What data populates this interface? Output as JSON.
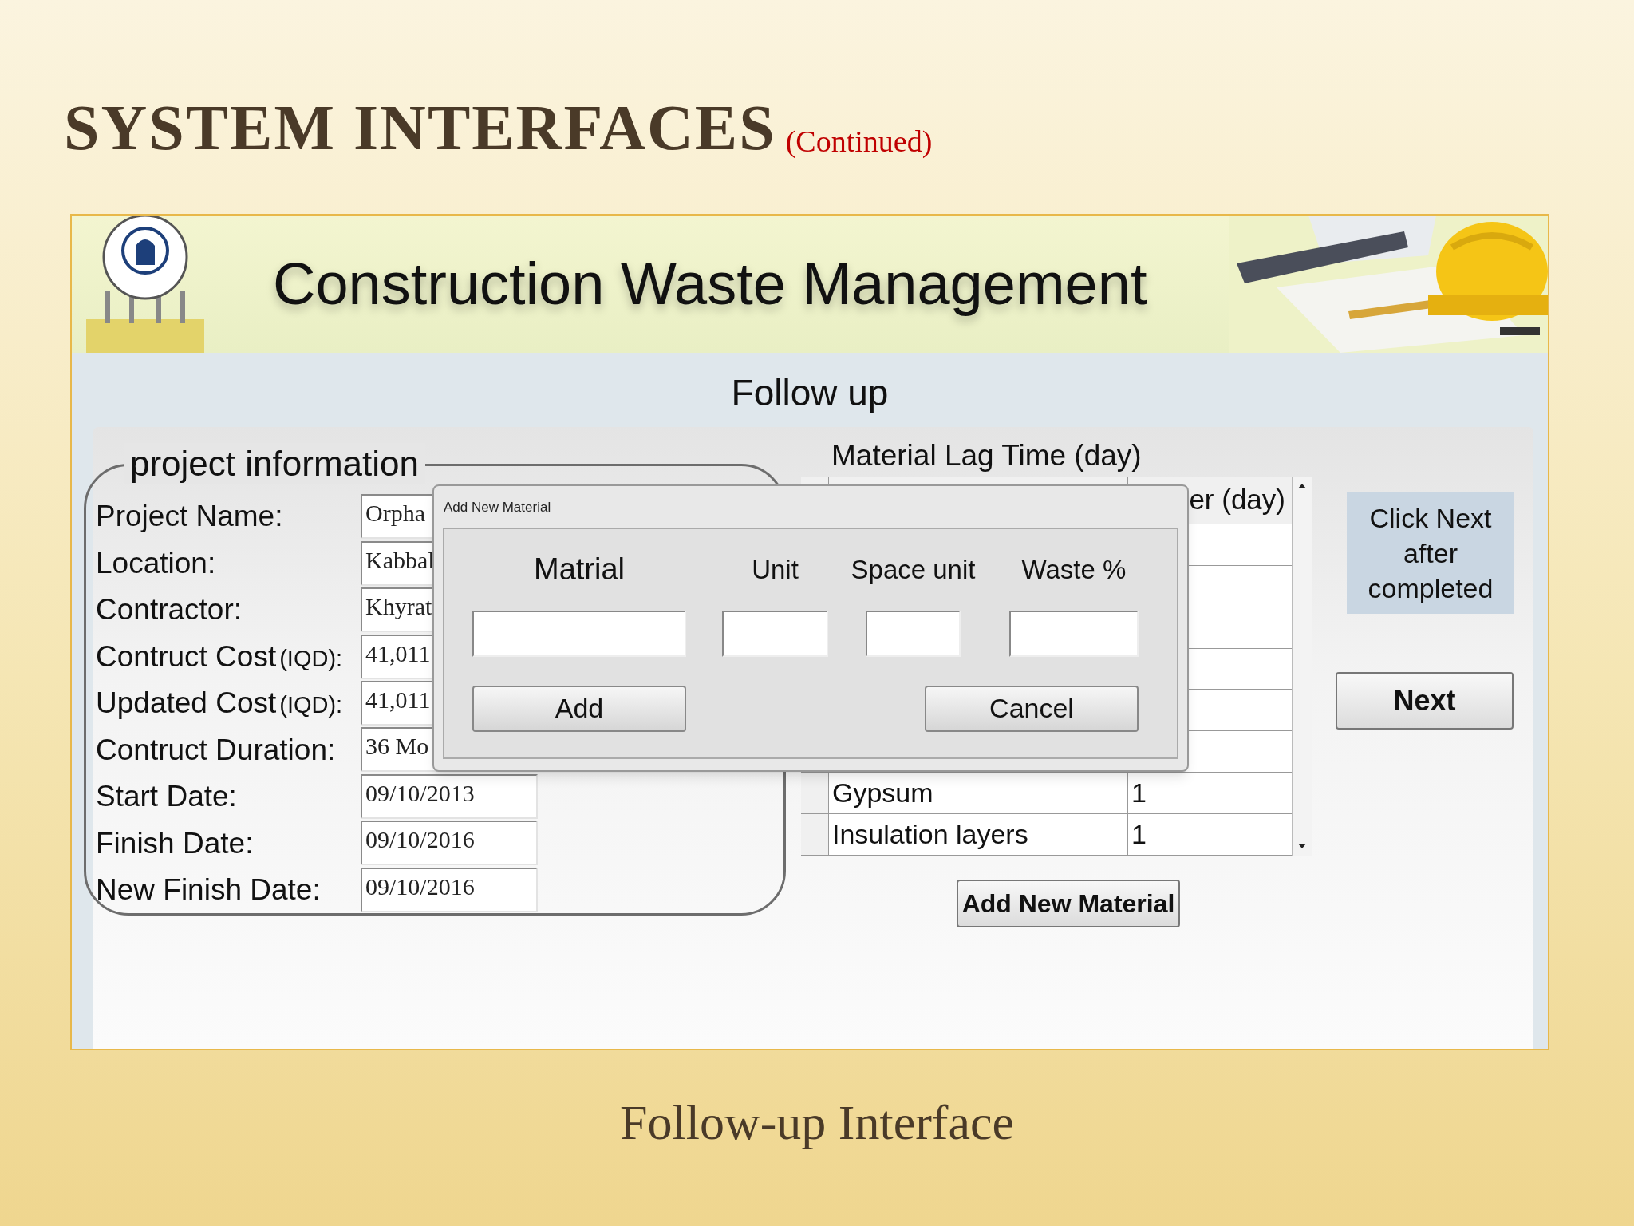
{
  "slide": {
    "title": "SYSTEM INTERFACES",
    "subtitle": "(Continued)",
    "caption": "Follow-up Interface"
  },
  "app": {
    "title": "Construction Waste Management",
    "page_title": "Follow up"
  },
  "project_information": {
    "title": "project information",
    "fields": [
      {
        "label": "Project Name:",
        "value": "Orpha"
      },
      {
        "label": "Location:",
        "value": "Kabbal"
      },
      {
        "label": "Contractor:",
        "value": "Khyrat"
      },
      {
        "label": "Contruct Cost",
        "unit": "(IQD):",
        "value": "41,011"
      },
      {
        "label": "Updated Cost",
        "unit": "(IQD):",
        "value": "41,011"
      },
      {
        "label": "Contruct Duration:",
        "value": "36 Mo"
      },
      {
        "label": "Start Date:",
        "value": "09/10/2013"
      },
      {
        "label": "Finish Date:",
        "value": "09/10/2016"
      },
      {
        "label": "New Finish Date:",
        "value": "09/10/2016"
      }
    ]
  },
  "material_lag": {
    "title": "Material Lag Time (day)",
    "column_2": "er (day)",
    "rows": [
      {
        "material": "Gypsum",
        "buffer": "1"
      },
      {
        "material": "Insulation layers",
        "buffer": "1"
      }
    ],
    "add_button": "Add New Material"
  },
  "hint": "Click Next after completed",
  "next_button": "Next",
  "dialog": {
    "title": "Add New Material",
    "columns": [
      "Matrial",
      "Unit",
      "Space unit",
      "Waste %"
    ],
    "buttons": [
      "Add",
      "Cancel"
    ]
  }
}
